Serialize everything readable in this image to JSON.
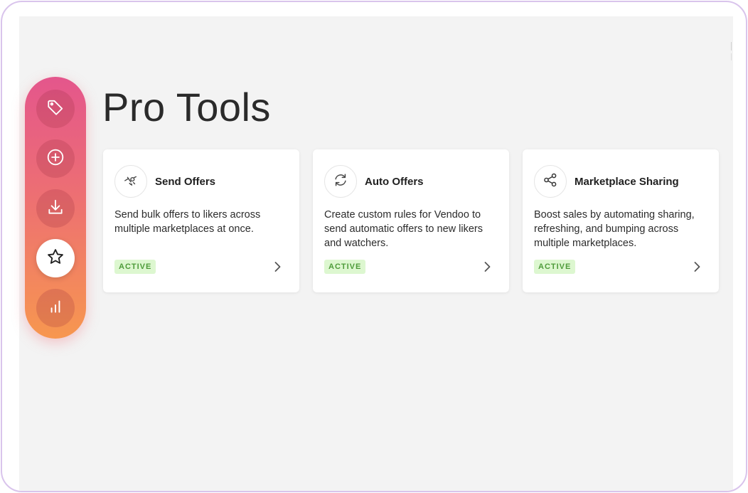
{
  "page": {
    "title": "Pro Tools"
  },
  "sidebar": {
    "items": [
      {
        "name": "tag",
        "icon": "tag-icon"
      },
      {
        "name": "add",
        "icon": "plus-circle-icon"
      },
      {
        "name": "import",
        "icon": "download-icon"
      },
      {
        "name": "pro-tools",
        "icon": "star-icon",
        "active": true
      },
      {
        "name": "analytics",
        "icon": "bar-chart-icon"
      }
    ]
  },
  "cards": [
    {
      "title": "Send Offers",
      "description": "Send bulk offers to likers across multiple marketplaces at once.",
      "status": "ACTIVE",
      "icon": "send-offers-icon"
    },
    {
      "title": "Auto Offers",
      "description": "Create custom rules for Vendoo to send automatic offers to new likers and watchers.",
      "status": "ACTIVE",
      "icon": "refresh-icon"
    },
    {
      "title": "Marketplace Sharing",
      "description": "Boost sales by automating sharing, refreshing, and bumping across multiple marketplaces.",
      "status": "ACTIVE",
      "icon": "share-icon"
    }
  ],
  "colors": {
    "sidebar_gradient_top": "#e4568c",
    "sidebar_gradient_bottom": "#f7974f",
    "badge_bg": "#ddf7d0",
    "badge_text": "#4e9b3a",
    "frame_border": "#d9c4ec"
  }
}
